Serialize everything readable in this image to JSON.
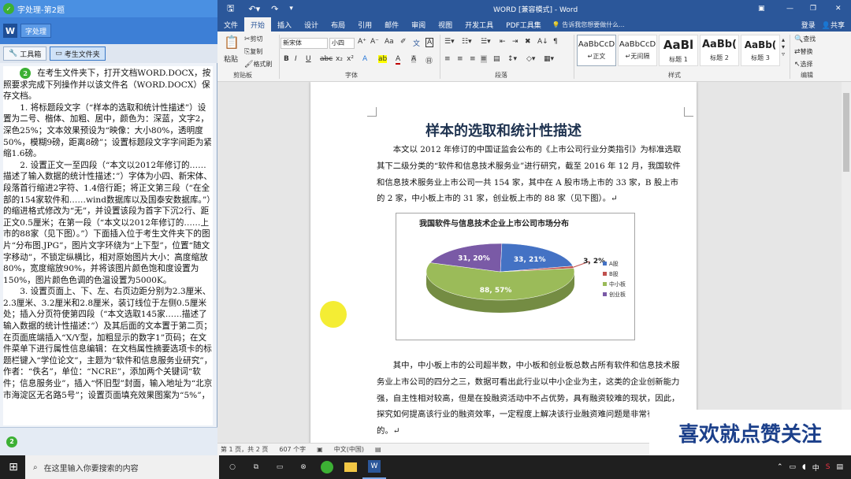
{
  "left_panel": {
    "title": "字处理-第2题",
    "app_button": "字处理",
    "toolbox_label": "工具箱",
    "folder_label": "考生文件夹",
    "circle_number": "2",
    "task_paragraphs": [
      "在考生文件夹下，打开文档WORD.DOCX，按照要求完成下列操作并以该文件名（WORD.DOCX）保存文档。",
      "1. 将标题段文字（“样本的选取和统计性描述”）设置为二号、楷体、加粗、居中，颜色为：深蓝，文字2，深色25%；文本效果预设为“映像：大小80%，透明度50%，模糊9磅，距离8磅”；设置标题段文字字间距为紧缩1.6磅。",
      "2. 设置正文一至四段（“本文以2012年修订的……描述了输入数据的统计性描述：”）字体为小四、新宋体、段落首行缩进2字符、1.4倍行距；将正文第三段（“在全部的154家软件和……wind数据库以及国泰安数据库。”）的缩进格式修改为“无”，并设置该段为首字下沉2行、距正文0.5厘米；在第一段（“本文以2012年修订的……上市的88家（见下图）。”）下面插入位于考生文件夹下的图片“分布图.JPG”，图片文字环绕为“上下型”，位置“随文字移动”，不锁定纵横比，相对原始图片大小：高度缩放80%，宽度缩放90%，并将该图片颜色饱和度设置为150%，图片颜色色调的色温设置为5000K。",
      "3. 设置页面上、下、左、右页边距分别为2.3厘米、2.3厘米、3.2厘米和2.8厘米，装订线位于左侧0.5厘米处；插入分页符使第四段（“本文选取145家……描述了输入数据的统计性描述：”）及其后面的文本置于第二页；在页面底端插入“X/Y型，加粗显示的数字1”页码；在文件菜单下进行属性信息编辑：在文档属性摘要选项卡的标题栏键入“学位论文”，主题为“软件和信息服务业研究”，作者：“佚名”，单位：“NCRE”，添加两个关键词“软件；信息服务业”，插入“怀旧型”封面，输入地址为“北京市海淀区无名路5号”；设置页面填充效果图案为“5%”，"
    ],
    "bottom_circle": "2"
  },
  "word": {
    "title": "WORD [兼容模式] - Word",
    "tabs": [
      "文件",
      "开始",
      "插入",
      "设计",
      "布局",
      "引用",
      "邮件",
      "审阅",
      "视图",
      "开发工具",
      "PDF工具集"
    ],
    "tell_me": "告诉我您想要做什么...",
    "login": "登录",
    "share": "共享",
    "clipboard": {
      "paste": "粘贴",
      "cut": "剪切",
      "copy": "复制",
      "format_painter": "格式刷",
      "label": "剪贴板"
    },
    "font": {
      "name": "新宋体",
      "size": "小四",
      "label": "字体"
    },
    "paragraph_label": "段落",
    "styles": {
      "items": [
        {
          "preview": "AaBbCcD",
          "name": "↵正文"
        },
        {
          "preview": "AaBbCcD",
          "name": "↵无间隔"
        },
        {
          "preview": "AaBl",
          "name": "标题 1"
        },
        {
          "preview": "AaBb(",
          "name": "标题 2"
        },
        {
          "preview": "AaBb(",
          "name": "标题 3"
        }
      ],
      "label": "样式"
    },
    "editing": {
      "find": "查找",
      "replace": "替换",
      "select": "选择",
      "label": "编辑"
    }
  },
  "document": {
    "title": "样本的选取和统计性描述",
    "para1": "本文以 2012 年修订的中国证监会公布的《上市公司行业分类指引》为标准选取其下二级分类的“软件和信息技术服务业”进行研究，截至 2016 年 12 月，我国软件和信息技术服务业上市公司一共 154 家，其中在 A 股市场上市的 33 家，B 股上市的 2 家，中小板上市的 31 家，创业板上市的 88 家（见下图）。↵",
    "para2": "其中，中小板上市的公司超半数，中小板和创业板总数占所有软件和信息技术服务业上市公司的四分之三，数据可看出此行业以中小企业为主，这类的企业创新能力强，自主性相对较高，但是在投融资活动中不占优势，具有融资较难的现状，因此，探究如何提高该行业的融资效率，一定程度上解决该行业融资难问题是非常有意义的。↵"
  },
  "chart_data": {
    "type": "pie",
    "title": "我国软件与信息技术企业上市公司市场分布",
    "categories": [
      "A股",
      "B股",
      "中小板",
      "创业板"
    ],
    "values": [
      33,
      2,
      88,
      31
    ],
    "slice_labels": [
      "33, 21%",
      "3, 2%",
      "88, 57%",
      "31, 20%"
    ],
    "colors": [
      "#4472c4",
      "#c0504d",
      "#9bbb59",
      "#7a5aa6"
    ],
    "legend_position": "right"
  },
  "status": {
    "page": "第 1 页，共 2 页",
    "words": "607 个字",
    "language": "中文(中国)"
  },
  "watermark": "喜欢就点赞关注",
  "taskbar": {
    "search_placeholder": "在这里输入你要搜索的内容",
    "ime": "中"
  }
}
